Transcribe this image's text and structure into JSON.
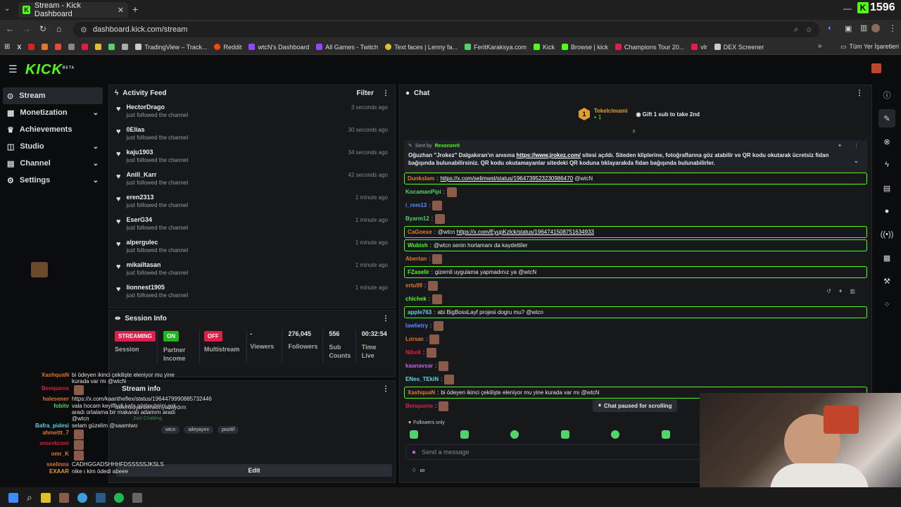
{
  "browser": {
    "tab_title": "Stream - Kick Dashboard",
    "url": "dashboard.kick.com/stream",
    "bookmarks": [
      "TradingView – Track...",
      "Reddit",
      "wtcN's Dashboard",
      "All Games - Twitch",
      "Text faces | Lenny fa...",
      "FeritKaraksya.com",
      "Kick",
      "Browse | kick",
      "Champions Tour 20...",
      "vlr",
      "DEX Screener"
    ],
    "bookmarks_folder": "Tüm Yer İşaretleri",
    "kick_counter": "1596"
  },
  "brand": {
    "logo": "KICK",
    "beta": "BETA",
    "accent": "#53fc18"
  },
  "sidebar": {
    "items": [
      {
        "label": "Stream",
        "icon": "broadcast-icon",
        "active": true,
        "chevron": false
      },
      {
        "label": "Monetization",
        "icon": "money-icon",
        "active": false,
        "chevron": true
      },
      {
        "label": "Achievements",
        "icon": "trophy-icon",
        "active": false,
        "chevron": false
      },
      {
        "label": "Studio",
        "icon": "studio-icon",
        "active": false,
        "chevron": true
      },
      {
        "label": "Channel",
        "icon": "channel-icon",
        "active": false,
        "chevron": true
      },
      {
        "label": "Settings",
        "icon": "gear-icon",
        "active": false,
        "chevron": true
      }
    ]
  },
  "activity": {
    "title": "Activity Feed",
    "filter": "Filter",
    "items": [
      {
        "name": "HectorDrago",
        "sub": "just followed the channel",
        "time": "3 seconds ago"
      },
      {
        "name": "0Elias",
        "sub": "just followed the channel",
        "time": "30 seconds ago"
      },
      {
        "name": "kaju1903",
        "sub": "just followed the channel",
        "time": "34 seconds ago"
      },
      {
        "name": "Anill_Karr",
        "sub": "just followed the channel",
        "time": "42 seconds ago"
      },
      {
        "name": "eren2313",
        "sub": "just followed the channel",
        "time": "1 minute ago"
      },
      {
        "name": "EserG34",
        "sub": "just followed the channel",
        "time": "1 minute ago"
      },
      {
        "name": "alpergulec",
        "sub": "just followed the channel",
        "time": "1 minute ago"
      },
      {
        "name": "mikailtasan",
        "sub": "just followed the channel",
        "time": "1 minute ago"
      },
      {
        "name": "lionnest1905",
        "sub": "just followed the channel",
        "time": "1 minute ago"
      }
    ]
  },
  "session": {
    "title": "Session Info",
    "stats": [
      {
        "badge": "STREAMING",
        "badge_color": "#e01e4a",
        "label": "Session"
      },
      {
        "badge": "ON",
        "badge_color": "#22b322",
        "label": "Partner Income"
      },
      {
        "badge": "OFF",
        "badge_color": "#e01e4a",
        "label": "Multistream"
      },
      {
        "value": "-",
        "label": "Viewers"
      },
      {
        "value": "276,045",
        "label": "Followers"
      },
      {
        "value": "556",
        "label": "Sub Counts"
      },
      {
        "value": "00:32:54",
        "label": "Time Live"
      }
    ]
  },
  "stream_info": {
    "title": "Stream info",
    "category": "Just Chatting",
    "tags": [
      "wtcn",
      "aileyayını",
      "pozitif"
    ],
    "edit": "Edit"
  },
  "chat": {
    "title": "Chat",
    "gift_user": "Tekelcimami",
    "gift_count": "1",
    "gift_rank": "1",
    "gift_text": "Gift 1 sub to take 2nd",
    "pinned_label": "Sent by",
    "pinned_user": "Rexonzer0",
    "pinned_text": "Oğuzhan \"Jrokez\" Dalgakıran'ın anısına https://www.jrokez.com/ sitesi açıldı. Siteden kliplerine, fotoğraflarına göz atabilir ve QR kodu okutarak ücretsiz fidan bağışında bulunabilirsiniz. QR kodu okutamayanlar sitedeki QR koduna tıklayarakda fidan bağışında bulunabilirler.",
    "messages": [
      {
        "user": "Dunkslam",
        "color": "#e07a2a",
        "text": "https://x.com/selimwst/status/1964739523230986470 @wtcN",
        "hl": true,
        "emote": false
      },
      {
        "user": "KocamanPipi",
        "color": "#53d46a",
        "text": "",
        "hl": false,
        "emote": true
      },
      {
        "user": "i_rem13",
        "color": "#5a8cff",
        "text": "",
        "hl": false,
        "emote": true
      },
      {
        "user": "Byarm12",
        "color": "#53d46a",
        "text": "",
        "hl": false,
        "emote": true
      },
      {
        "user": "CaGoexe",
        "color": "#e07a2a",
        "text": "@wtcn https://x.com/EyupKzlck/status/1964741508751634933",
        "hl": true,
        "emote": false
      },
      {
        "user": "Wubish",
        "color": "#53fc18",
        "text": "@wtcn senin horlamanı da kaydettiler",
        "hl": true,
        "emote": false
      },
      {
        "user": "Abertan",
        "color": "#e07a2a",
        "text": "",
        "hl": false,
        "emote": true
      },
      {
        "user": "FZaselir",
        "color": "#53fc18",
        "text": "gizemli uygulama yapmadınız ya @wtcN",
        "hl": true,
        "emote": false
      },
      {
        "user": "ertu99",
        "color": "#e07a2a",
        "text": "",
        "hl": false,
        "emote": true
      },
      {
        "user": "chichek",
        "color": "#53fc18",
        "text": "",
        "hl": false,
        "emote": true
      },
      {
        "user": "apple763",
        "color": "#5ad6e0",
        "text": "abi BigBossLayf projesi dogru mu? @wtcn",
        "hl": true,
        "emote": false
      },
      {
        "user": "lawlietry",
        "color": "#5a8cff",
        "text": "",
        "hl": false,
        "emote": true
      },
      {
        "user": "Lorsac",
        "color": "#e07a2a",
        "text": "",
        "hl": false,
        "emote": true
      },
      {
        "user": "Nibell",
        "color": "#e01e4a",
        "text": "",
        "hl": false,
        "emote": true
      },
      {
        "user": "kaanavsar",
        "color": "#c06ad6",
        "text": "",
        "hl": false,
        "emote": true
      },
      {
        "user": "ENes_TEkiN",
        "color": "#5ad6e0",
        "text": "",
        "hl": false,
        "emote": true
      },
      {
        "user": "XashquaN",
        "color": "#e07a2a",
        "text": "bi ödeyen ikinci çekilişte eleniyor mu yine kurada var mı @wtcN",
        "hl": true,
        "emote": false
      },
      {
        "user": "Benqueno",
        "color": "#e01e4a",
        "text": "",
        "hl": false,
        "emote": true
      }
    ],
    "paused": "Chat paused for scrolling",
    "followers_only": "Followers only",
    "send_placeholder": "Send a message"
  },
  "overlay_chat": [
    {
      "user": "XashquaN",
      "color": "#e07a2a",
      "text": "bi ödeyen ikinci çekilişte eleniyor mu yine kurada var mı @wtcN"
    },
    {
      "user": "Benqueno",
      "color": "#e01e4a",
      "text": ""
    },
    {
      "user": "halesener",
      "color": "#e07a2a",
      "text": "https://x.com/kaantheflex/status/1964479990885732446"
    },
    {
      "user": "fobitv",
      "color": "#53d46a",
      "text": "vala hocam keyifliydi kafa gözler birini çok aradı ortalama bir makaralı adamını aradı @wtcn"
    },
    {
      "user": "Bafra_pidesi",
      "color": "#5ad6e0",
      "text": "selam güzelim @saamtwo"
    },
    {
      "user": "ahmettt_7",
      "color": "#e07a2a",
      "text": ""
    },
    {
      "user": "onurrkcmn",
      "color": "#e01e4a",
      "text": ""
    },
    {
      "user": "omr_K",
      "color": "#e07a2a",
      "text": ""
    },
    {
      "user": "sselinns",
      "color": "#e07a2a",
      "text": "CADHGGADSHHHFDSSSSSJKSLS"
    },
    {
      "user": "EXAAR",
      "color": "#e0a02a",
      "text": "nike ı kim ödedi abeee"
    }
  ],
  "overlay_extra": "neleroluyorbenkonyadaydım"
}
